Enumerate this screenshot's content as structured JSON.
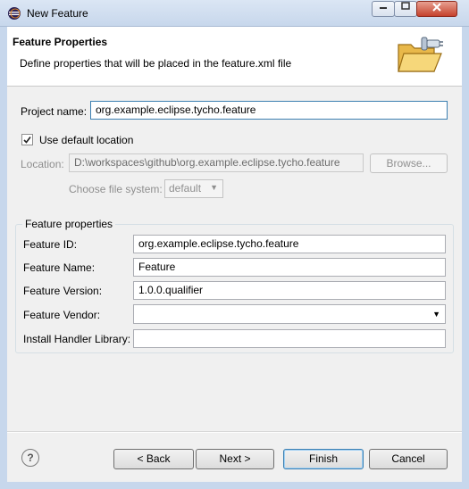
{
  "window": {
    "title": "New Feature"
  },
  "header": {
    "title": "Feature Properties",
    "description": "Define properties that will be placed in the feature.xml file"
  },
  "project": {
    "label": "Project name:",
    "value": "org.example.eclipse.tycho.feature"
  },
  "location": {
    "use_default_label": "Use default location",
    "use_default_checked": true,
    "label": "Location:",
    "value": "D:\\workspaces\\github\\org.example.eclipse.tycho.feature",
    "browse_label": "Browse...",
    "file_system_label": "Choose file system:",
    "file_system_value": "default"
  },
  "feature_properties": {
    "group_title": "Feature properties",
    "id_label": "Feature ID:",
    "id_value": "org.example.eclipse.tycho.feature",
    "name_label": "Feature Name:",
    "name_value": "Feature",
    "version_label": "Feature Version:",
    "version_value": "1.0.0.qualifier",
    "vendor_label": "Feature Vendor:",
    "vendor_value": "",
    "handler_label": "Install Handler Library:",
    "handler_value": ""
  },
  "footer": {
    "help_label": "?",
    "back_label": "< Back",
    "next_label": "Next >",
    "finish_label": "Finish",
    "cancel_label": "Cancel"
  },
  "icons": [
    "eclipse-icon",
    "folder-plug-icon",
    "checkmark-icon",
    "dropdown-arrow-icon",
    "help-icon"
  ]
}
